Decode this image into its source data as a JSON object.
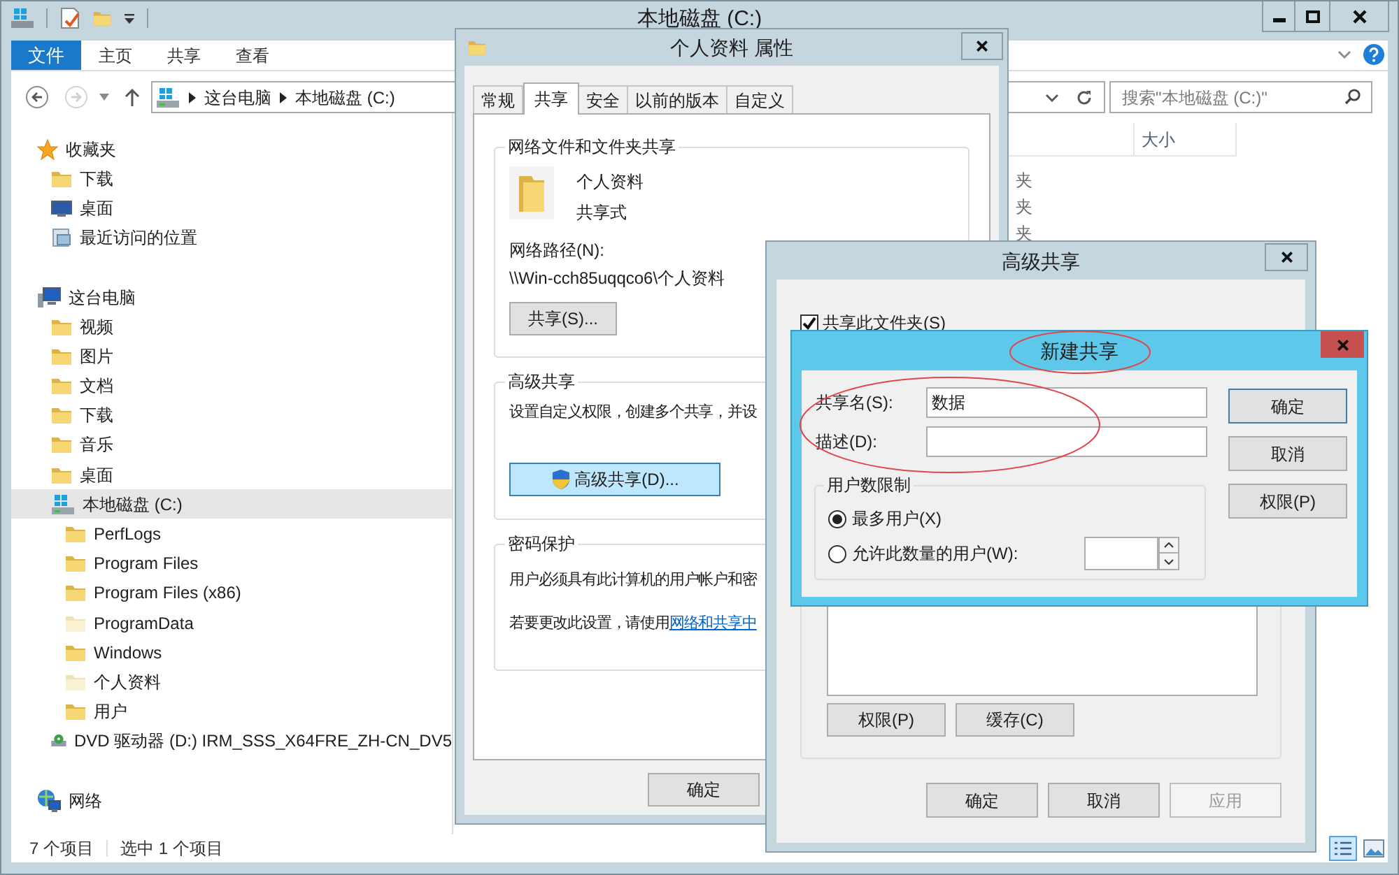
{
  "explorer": {
    "title": "本地磁盘 (C:)",
    "ribbon_tabs": [
      {
        "label": "文件",
        "selected": true
      },
      {
        "label": "主页",
        "selected": false
      },
      {
        "label": "共享",
        "selected": false
      },
      {
        "label": "查看",
        "selected": false
      }
    ],
    "breadcrumb": [
      "这台电脑",
      "本地磁盘 (C:)"
    ],
    "search": {
      "placeholder": "搜索\"本地磁盘 (C:)\""
    },
    "nav": [
      {
        "label": "收藏夹",
        "kind": "favorites",
        "selected": false,
        "children": [
          {
            "label": "下载",
            "kind": "folder",
            "selected": false
          },
          {
            "label": "桌面",
            "kind": "desktop",
            "selected": false
          },
          {
            "label": "最近访问的位置",
            "kind": "recent",
            "selected": false
          }
        ]
      },
      {
        "label": "这台电脑",
        "kind": "computer",
        "selected": false,
        "children": [
          {
            "label": "视频",
            "kind": "folder",
            "selected": false
          },
          {
            "label": "图片",
            "kind": "folder",
            "selected": false
          },
          {
            "label": "文档",
            "kind": "folder",
            "selected": false
          },
          {
            "label": "下载",
            "kind": "folder",
            "selected": false
          },
          {
            "label": "音乐",
            "kind": "folder",
            "selected": false
          },
          {
            "label": "桌面",
            "kind": "folder",
            "selected": false
          },
          {
            "label": "本地磁盘 (C:)",
            "kind": "drive",
            "selected": true,
            "children": [
              {
                "label": "PerfLogs",
                "kind": "folder",
                "selected": false
              },
              {
                "label": "Program Files",
                "kind": "folder",
                "selected": false
              },
              {
                "label": "Program Files (x86)",
                "kind": "folder",
                "selected": false
              },
              {
                "label": "ProgramData",
                "kind": "hiddenfolder",
                "selected": false
              },
              {
                "label": "Windows",
                "kind": "folder",
                "selected": false
              },
              {
                "label": "个人资料",
                "kind": "hiddenfolder",
                "selected": false
              },
              {
                "label": "用户",
                "kind": "folder",
                "selected": false
              }
            ]
          },
          {
            "label": "DVD 驱动器 (D:) IRM_SSS_X64FRE_ZH-CN_DV5",
            "kind": "dvd",
            "selected": false
          }
        ]
      },
      {
        "label": "网络",
        "kind": "network",
        "selected": false
      }
    ],
    "size_header": "大小",
    "column_1_cells": [
      "夹",
      "夹",
      "夹"
    ],
    "status_bar": [
      "7 个项目",
      "选中 1 个项目"
    ]
  },
  "properties": {
    "title": "个人资料 属性",
    "tabs": [
      {
        "label": "常规",
        "selected": false
      },
      {
        "label": "共享",
        "selected": true
      },
      {
        "label": "安全",
        "selected": false
      },
      {
        "label": "以前的版本",
        "selected": false
      },
      {
        "label": "自定义",
        "selected": false
      }
    ],
    "network_sharing": {
      "heading": "网络文件和文件夹共享",
      "name": "个人资料",
      "state": "共享式",
      "path_label": "网络路径(N):",
      "path": "\\\\Win-cch85uqqco6\\个人资料",
      "button": "共享(S)..."
    },
    "advanced": {
      "heading": "高级共享",
      "description": "设置自定义权限，创建多个共享，并设",
      "button": "高级共享(D)..."
    },
    "password": {
      "heading": "密码保护",
      "description": "用户必须具有此计算机的用户帐户和密",
      "hint": "若要更改此设置，请使用",
      "link": "网络和共享中"
    },
    "buttons": [
      "确定"
    ]
  },
  "advanced_sharing": {
    "title": "高级共享",
    "share_folder": {
      "label": "共享此文件夹(S)",
      "checked": true
    },
    "group_buttons": [
      "权限(P)",
      "缓存(C)"
    ],
    "buttons": [
      {
        "label": "确定",
        "disabled": false
      },
      {
        "label": "取消",
        "disabled": false
      },
      {
        "label": "应用",
        "disabled": true
      }
    ]
  },
  "new_share": {
    "title": "新建共享",
    "fields": [
      {
        "label": "共享名(S):",
        "value": "数据"
      },
      {
        "label": "描述(D):"
      }
    ],
    "user_limit": {
      "heading": "用户数限制",
      "options": [
        {
          "label": "最多用户(X)",
          "selected": true
        },
        {
          "label": "允许此数量的用户(W):",
          "selected": false
        }
      ]
    },
    "buttons": [
      {
        "label": "确定",
        "default": true
      },
      {
        "label": "取消",
        "default": false
      },
      {
        "label": "权限(P)",
        "default": false
      }
    ]
  }
}
